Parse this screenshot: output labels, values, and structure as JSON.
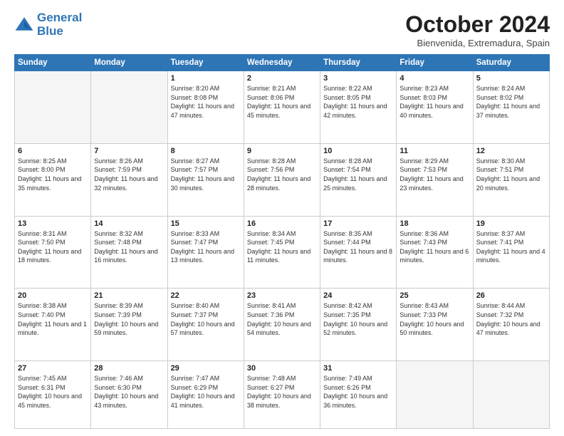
{
  "header": {
    "logo_line1": "General",
    "logo_line2": "Blue",
    "month": "October 2024",
    "location": "Bienvenida, Extremadura, Spain"
  },
  "weekdays": [
    "Sunday",
    "Monday",
    "Tuesday",
    "Wednesday",
    "Thursday",
    "Friday",
    "Saturday"
  ],
  "weeks": [
    [
      {
        "day": "",
        "info": ""
      },
      {
        "day": "",
        "info": ""
      },
      {
        "day": "1",
        "info": "Sunrise: 8:20 AM\nSunset: 8:08 PM\nDaylight: 11 hours and 47 minutes."
      },
      {
        "day": "2",
        "info": "Sunrise: 8:21 AM\nSunset: 8:06 PM\nDaylight: 11 hours and 45 minutes."
      },
      {
        "day": "3",
        "info": "Sunrise: 8:22 AM\nSunset: 8:05 PM\nDaylight: 11 hours and 42 minutes."
      },
      {
        "day": "4",
        "info": "Sunrise: 8:23 AM\nSunset: 8:03 PM\nDaylight: 11 hours and 40 minutes."
      },
      {
        "day": "5",
        "info": "Sunrise: 8:24 AM\nSunset: 8:02 PM\nDaylight: 11 hours and 37 minutes."
      }
    ],
    [
      {
        "day": "6",
        "info": "Sunrise: 8:25 AM\nSunset: 8:00 PM\nDaylight: 11 hours and 35 minutes."
      },
      {
        "day": "7",
        "info": "Sunrise: 8:26 AM\nSunset: 7:59 PM\nDaylight: 11 hours and 32 minutes."
      },
      {
        "day": "8",
        "info": "Sunrise: 8:27 AM\nSunset: 7:57 PM\nDaylight: 11 hours and 30 minutes."
      },
      {
        "day": "9",
        "info": "Sunrise: 8:28 AM\nSunset: 7:56 PM\nDaylight: 11 hours and 28 minutes."
      },
      {
        "day": "10",
        "info": "Sunrise: 8:28 AM\nSunset: 7:54 PM\nDaylight: 11 hours and 25 minutes."
      },
      {
        "day": "11",
        "info": "Sunrise: 8:29 AM\nSunset: 7:53 PM\nDaylight: 11 hours and 23 minutes."
      },
      {
        "day": "12",
        "info": "Sunrise: 8:30 AM\nSunset: 7:51 PM\nDaylight: 11 hours and 20 minutes."
      }
    ],
    [
      {
        "day": "13",
        "info": "Sunrise: 8:31 AM\nSunset: 7:50 PM\nDaylight: 11 hours and 18 minutes."
      },
      {
        "day": "14",
        "info": "Sunrise: 8:32 AM\nSunset: 7:48 PM\nDaylight: 11 hours and 16 minutes."
      },
      {
        "day": "15",
        "info": "Sunrise: 8:33 AM\nSunset: 7:47 PM\nDaylight: 11 hours and 13 minutes."
      },
      {
        "day": "16",
        "info": "Sunrise: 8:34 AM\nSunset: 7:45 PM\nDaylight: 11 hours and 11 minutes."
      },
      {
        "day": "17",
        "info": "Sunrise: 8:35 AM\nSunset: 7:44 PM\nDaylight: 11 hours and 8 minutes."
      },
      {
        "day": "18",
        "info": "Sunrise: 8:36 AM\nSunset: 7:43 PM\nDaylight: 11 hours and 6 minutes."
      },
      {
        "day": "19",
        "info": "Sunrise: 8:37 AM\nSunset: 7:41 PM\nDaylight: 11 hours and 4 minutes."
      }
    ],
    [
      {
        "day": "20",
        "info": "Sunrise: 8:38 AM\nSunset: 7:40 PM\nDaylight: 11 hours and 1 minute."
      },
      {
        "day": "21",
        "info": "Sunrise: 8:39 AM\nSunset: 7:39 PM\nDaylight: 10 hours and 59 minutes."
      },
      {
        "day": "22",
        "info": "Sunrise: 8:40 AM\nSunset: 7:37 PM\nDaylight: 10 hours and 57 minutes."
      },
      {
        "day": "23",
        "info": "Sunrise: 8:41 AM\nSunset: 7:36 PM\nDaylight: 10 hours and 54 minutes."
      },
      {
        "day": "24",
        "info": "Sunrise: 8:42 AM\nSunset: 7:35 PM\nDaylight: 10 hours and 52 minutes."
      },
      {
        "day": "25",
        "info": "Sunrise: 8:43 AM\nSunset: 7:33 PM\nDaylight: 10 hours and 50 minutes."
      },
      {
        "day": "26",
        "info": "Sunrise: 8:44 AM\nSunset: 7:32 PM\nDaylight: 10 hours and 47 minutes."
      }
    ],
    [
      {
        "day": "27",
        "info": "Sunrise: 7:45 AM\nSunset: 6:31 PM\nDaylight: 10 hours and 45 minutes."
      },
      {
        "day": "28",
        "info": "Sunrise: 7:46 AM\nSunset: 6:30 PM\nDaylight: 10 hours and 43 minutes."
      },
      {
        "day": "29",
        "info": "Sunrise: 7:47 AM\nSunset: 6:29 PM\nDaylight: 10 hours and 41 minutes."
      },
      {
        "day": "30",
        "info": "Sunrise: 7:48 AM\nSunset: 6:27 PM\nDaylight: 10 hours and 38 minutes."
      },
      {
        "day": "31",
        "info": "Sunrise: 7:49 AM\nSunset: 6:26 PM\nDaylight: 10 hours and 36 minutes."
      },
      {
        "day": "",
        "info": ""
      },
      {
        "day": "",
        "info": ""
      }
    ]
  ]
}
